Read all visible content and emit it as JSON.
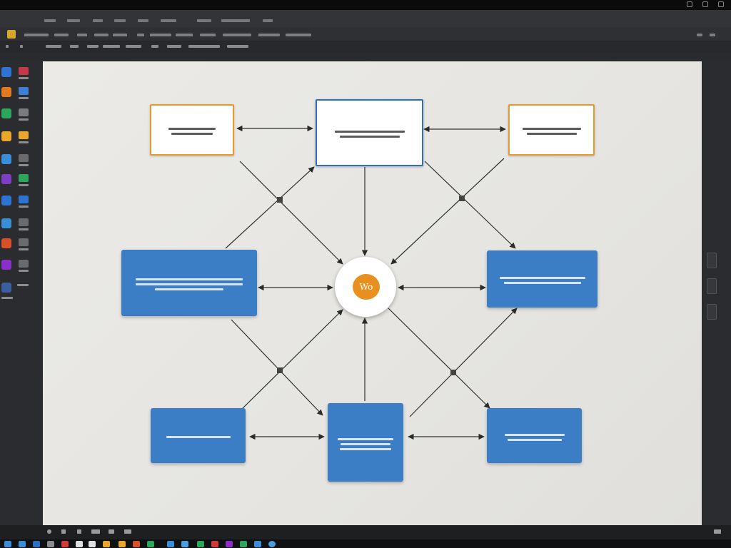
{
  "window": {
    "app_name": "",
    "doc_title": ""
  },
  "hub": {
    "label": "Wo"
  },
  "nodes": {
    "top_left": {
      "title": ""
    },
    "top_center": {
      "title": ""
    },
    "top_right": {
      "title": ""
    },
    "mid_left": {
      "title": ""
    },
    "mid_right": {
      "title": ""
    },
    "bottom_left": {
      "title": ""
    },
    "bottom_center": {
      "title": ""
    },
    "bottom_right": {
      "title": ""
    }
  },
  "colors": {
    "accent_orange": "#e8901f",
    "node_blue": "#3c7ec6",
    "outline_blue": "#2f6fbd",
    "outline_orange": "#e59a2e"
  },
  "icons": [
    "minimize-icon",
    "maximize-icon",
    "close-icon",
    "hub-circle"
  ]
}
